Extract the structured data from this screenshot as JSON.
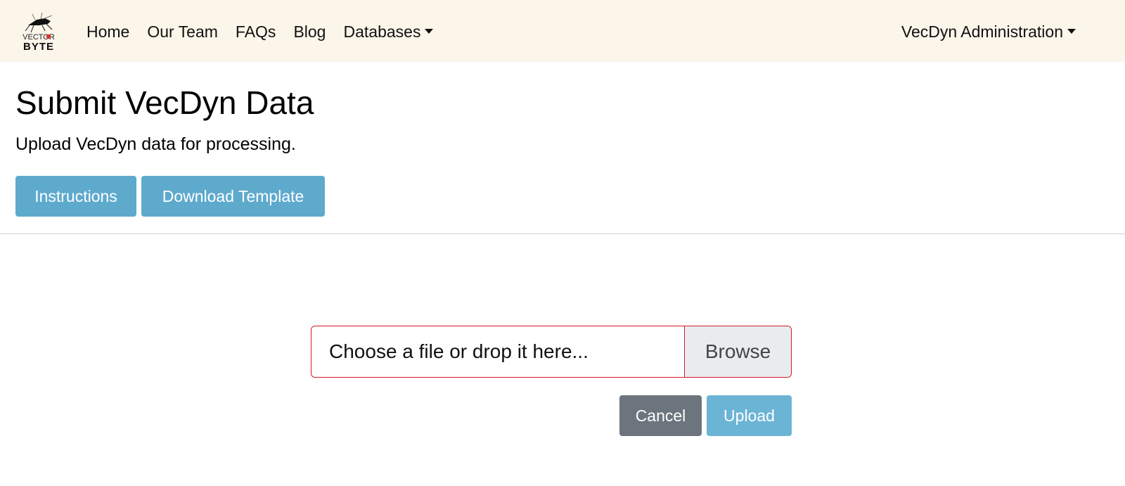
{
  "navbar": {
    "brand": {
      "line1": "VECTOR",
      "line2": "BYTE",
      "icon": "mosquito-logo-icon"
    },
    "links": [
      {
        "label": "Home"
      },
      {
        "label": "Our Team"
      },
      {
        "label": "FAQs"
      },
      {
        "label": "Blog"
      },
      {
        "label": "Databases",
        "dropdown": true
      }
    ],
    "right": {
      "label": "VecDyn Administration",
      "dropdown": true
    }
  },
  "page": {
    "title": "Submit VecDyn Data",
    "subtitle": "Upload VecDyn data for processing."
  },
  "actions": {
    "instructions_label": "Instructions",
    "template_label": "Download Template"
  },
  "upload": {
    "placeholder": "Choose a file or drop it here...",
    "browse_label": "Browse",
    "cancel_label": "Cancel",
    "upload_label": "Upload"
  },
  "colors": {
    "navbar_bg": "#fcf5ea",
    "info": "#5eaacd",
    "secondary": "#6c757d",
    "invalid_border": "#d3192b"
  }
}
